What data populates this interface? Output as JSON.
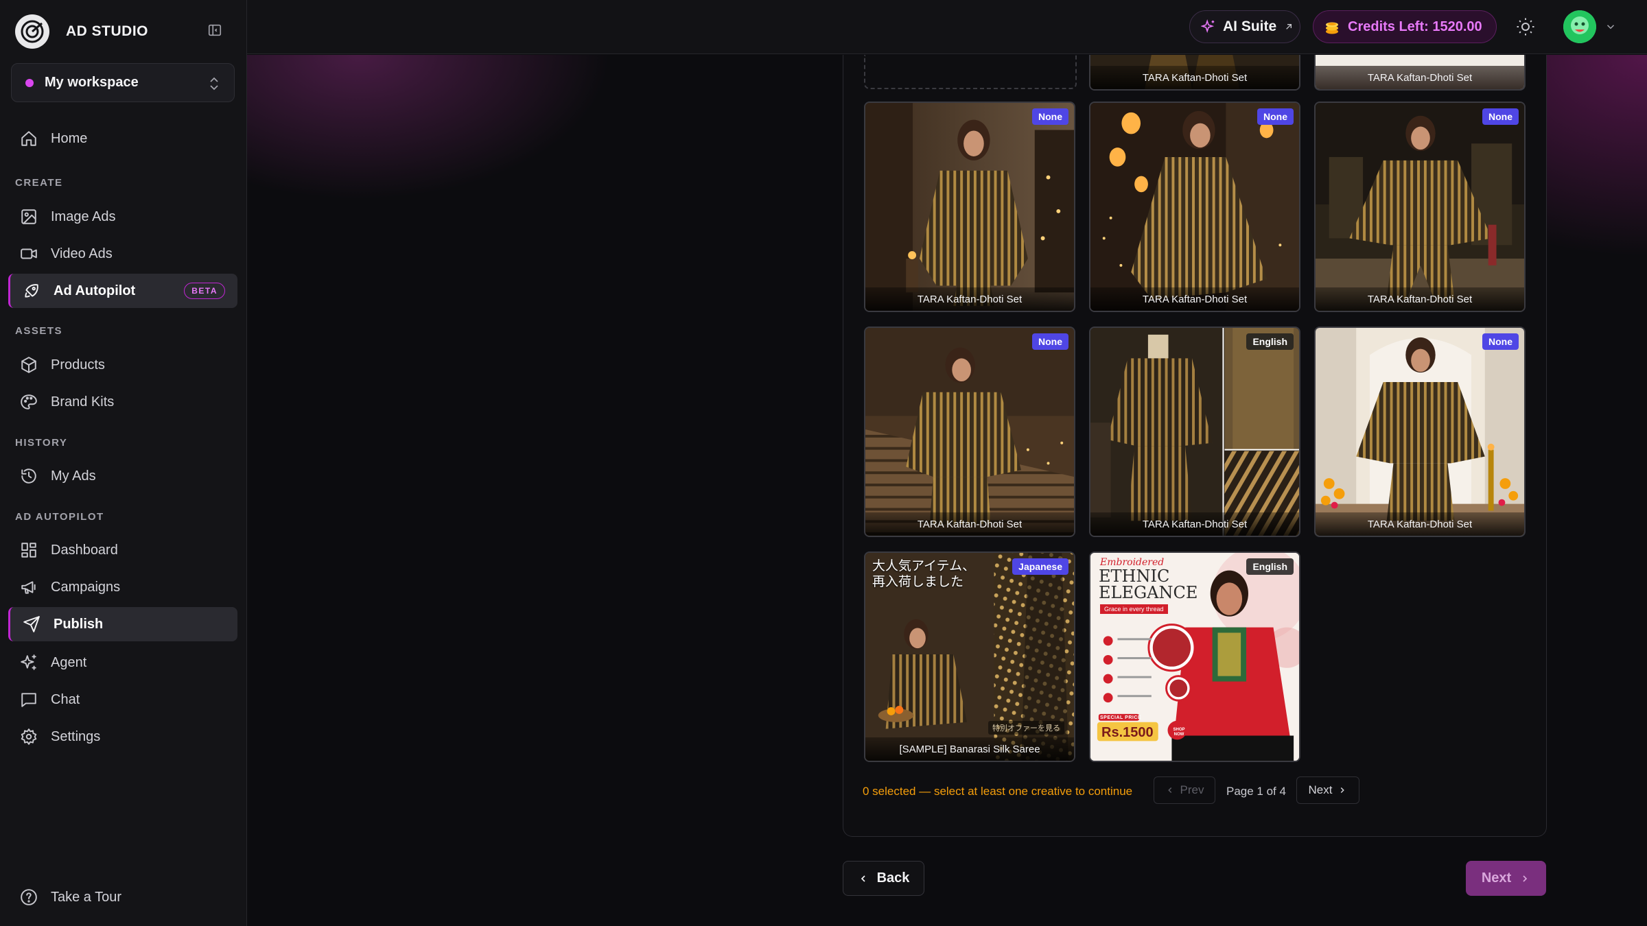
{
  "app": {
    "name": "AD STUDIO"
  },
  "workspace": {
    "name": "My workspace"
  },
  "sidebar": {
    "home": "Home",
    "sections": {
      "create": "CREATE",
      "assets": "ASSETS",
      "history": "HISTORY",
      "autopilot": "AD AUTOPILOT"
    },
    "items": {
      "image_ads": "Image Ads",
      "video_ads": "Video Ads",
      "ad_autopilot": "Ad Autopilot",
      "beta": "BETA",
      "products": "Products",
      "brand_kits": "Brand Kits",
      "my_ads": "My Ads",
      "dashboard": "Dashboard",
      "campaigns": "Campaigns",
      "publish": "Publish",
      "agent": "Agent",
      "chat": "Chat",
      "settings": "Settings"
    },
    "tour": "Take a Tour"
  },
  "topbar": {
    "ai_suite": "AI Suite",
    "credits": "Credits Left: 1520.00"
  },
  "grid": {
    "top_row": [
      {
        "caption": ""
      },
      {
        "caption": "TARA Kaftan-Dhoti Set"
      },
      {
        "caption": "TARA Kaftan-Dhoti Set"
      }
    ],
    "cards": [
      {
        "caption": "TARA Kaftan-Dhoti Set",
        "badge": "None"
      },
      {
        "caption": "TARA Kaftan-Dhoti Set",
        "badge": "None"
      },
      {
        "caption": "TARA Kaftan-Dhoti Set",
        "badge": "None"
      },
      {
        "caption": "TARA Kaftan-Dhoti Set",
        "badge": "None"
      },
      {
        "caption": "TARA Kaftan-Dhoti Set",
        "badge": "English"
      },
      {
        "caption": "TARA Kaftan-Dhoti Set",
        "badge": "None"
      },
      {
        "caption": "[SAMPLE] Banarasi Silk Saree",
        "badge": "Japanese"
      },
      {
        "caption": "",
        "badge": "English"
      }
    ],
    "ad7": {
      "jp_line1": "大人気アイテム、",
      "jp_line2": "再入荷しました",
      "jp_cta": "特別オファーを見る"
    },
    "ad8": {
      "script": "Embroidered",
      "line1": "ETHNIC",
      "line2": "ELEGANCE",
      "tag": "Grace in every thread",
      "special": "SPECIAL PRICE",
      "price": "Rs.1500",
      "shop": "SHOP NOW"
    }
  },
  "footer": {
    "status": "0 selected — select at least one creative to continue",
    "prev": "Prev",
    "page": "Page 1 of 4",
    "next_page": "Next",
    "back": "Back",
    "next": "Next"
  },
  "colors": {
    "accent": "#c026d3",
    "badge_none": "#4f46e5",
    "warning": "#f59e0b"
  }
}
